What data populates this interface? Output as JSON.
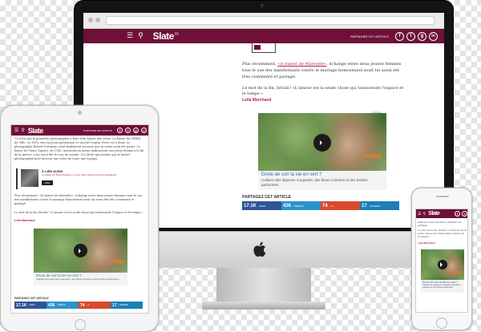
{
  "colors": {
    "brand": "#6e1038",
    "link": "#b6234a",
    "twitter": "#2b93ce",
    "facebook": "#2f5597",
    "google": "#d94a2c",
    "linkedin": "#1b7fb8",
    "coop": "#ff7a1a"
  },
  "desktop": {
    "logo": "Slate",
    "logo_mark": "FR",
    "share_label": "PARTAGER CET ARTICLE",
    "social": [
      "f",
      "t",
      "g",
      "in"
    ],
    "para1_prefix": "Plus récemment, ",
    "para1_link": "«le baiser de Marseille»",
    "para1_rest": ", échange entre deux jeunes femmes tous le sue des manifestants contre le mariage homosexuel avait lui aussi été très commenté et partagé.",
    "para2": "Le mot de la fin, Istvàn? «L'amour est la seule chose qui transcende l'espace et le temps.»",
    "author": "Leila Marchand",
    "ad_label": "Publicité",
    "video_title": "Envie de voir la vie en vert ?",
    "video_desc": "Cultivez des légumes croquants, des fleurs colorées et des herbes parfumées.",
    "coop": "coop",
    "share_heading": "PARTAGEZ CET ARTICLE",
    "stats": [
      {
        "n": "17.1K",
        "l": "LIKES"
      },
      {
        "n": "436",
        "l": "TWEETS"
      },
      {
        "n": "74",
        "l": "+1"
      },
      {
        "n": "17",
        "l": "LINKEDIN"
      }
    ]
  },
  "tablet": {
    "logo": "Slate",
    "share_label": "PARTAGER CET ARTICLE",
    "social": [
      "f",
      "t",
      "g",
      "in"
    ],
    "top_text": "Ce n'est pas la première photographie à faire d'un baiser une icône. Le Baiser de l'Hôtel de Ville, en 1950, ému la jeune génération et suscité l'espoir d'une vie à deux. Le photographe Robert Doisneau avait finalement reconnu que la scène avait été posée. Le baiser de Times Square, en 1945, montrant un marin embrassant une jeune femme à la fin de la guerre, a lui aussi fait le tour du monde. Un cliché qui montre que le baiser photographié peut devenir une icône de toute une époque.",
    "also_label": "À LIRE AUSSI",
    "also_link": "Le baiser de Times Square a un rôle dans l'histoire de la photographie",
    "also_btn": "LIRE",
    "para1": "Plus récemment, «le baiser de Marseille», échange entre deux jeunes femmes sous le sue des manifestants contre le mariage homosexuel avait lui aussi été très commenté et partagé.",
    "para2": "Le mot de la fin, Istvàn? «L'amour est la seule chose qui transcende l'espace et le temps.»",
    "author": "Leila Marchand",
    "video_title": "Envie de voir la vie en vert ?",
    "video_desc": "Cultivez des légumes croquants, des fleurs colorées et des herbes parfumées.",
    "coop": "coop",
    "share_heading": "PARTAGEZ CET ARTICLE",
    "stats": [
      {
        "n": "17.1K",
        "l": "LIKES"
      },
      {
        "n": "436",
        "l": "TWEETS"
      },
      {
        "n": "74",
        "l": "+1"
      },
      {
        "n": "17",
        "l": "LINKEDIN"
      }
    ]
  },
  "phone": {
    "logo": "Slate",
    "social": [
      "f",
      "t"
    ],
    "text1": "avait lui aussi été très commenté et partagé.",
    "text2": "Le mot de la fin, Istvàn? «L'amour est la seule chose qui transcende l'espace et le temps.»",
    "author": "Leila Marchand",
    "video_title": "Envie de voir la vie en vert ?",
    "video_desc": "Cultivez des légumes croquants, des fleurs colorées et des herbes parfumées.",
    "coop": "coop"
  }
}
